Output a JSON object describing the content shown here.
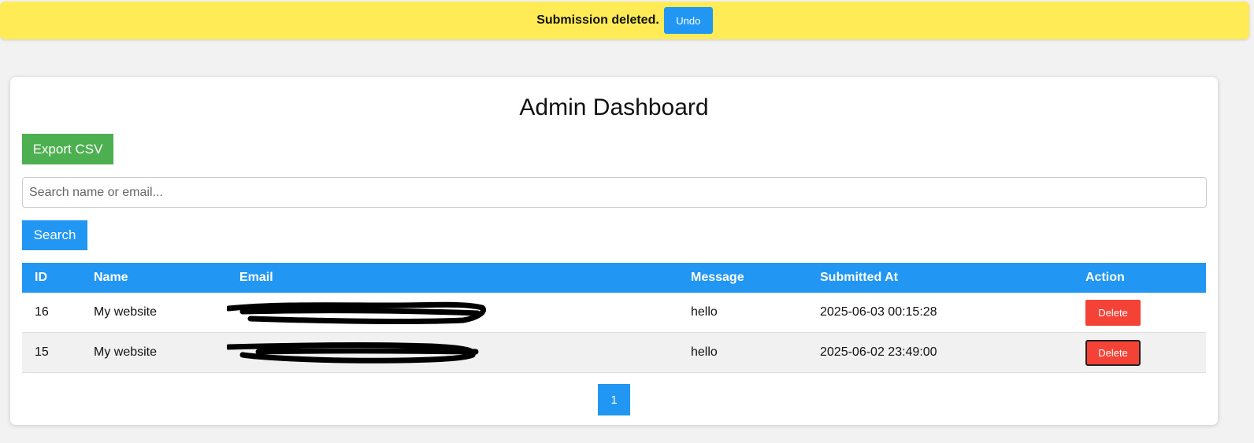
{
  "toast": {
    "message": "Submission deleted.",
    "undo_label": "Undo"
  },
  "dashboard": {
    "title": "Admin Dashboard",
    "export_label": "Export CSV",
    "search_placeholder": "Search name or email...",
    "search_value": "",
    "search_label": "Search"
  },
  "table": {
    "headers": [
      "ID",
      "Name",
      "Email",
      "Message",
      "Submitted At",
      "Action"
    ],
    "rows": [
      {
        "id": "16",
        "name": "My website",
        "message": "hello",
        "submitted_at": "2025-06-03 00:15:28",
        "action": "Delete"
      },
      {
        "id": "15",
        "name": "My website",
        "message": "hello",
        "submitted_at": "2025-06-02 23:49:00",
        "action": "Delete"
      }
    ]
  },
  "pagination": {
    "current_page": "1"
  },
  "colors": {
    "toast_bg": "#ffeb55",
    "primary": "#2196f3",
    "success": "#4caf50",
    "danger": "#f44336"
  }
}
